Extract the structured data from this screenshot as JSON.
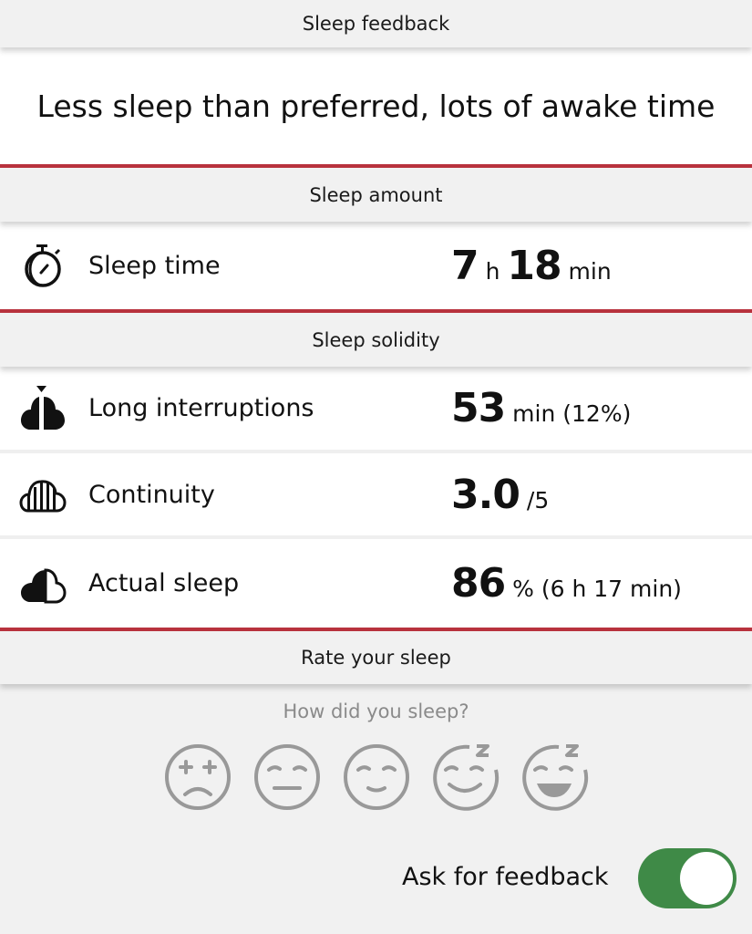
{
  "header": {
    "title": "Sleep feedback"
  },
  "feedback": {
    "text": "Less sleep than preferred, lots of awake time"
  },
  "sections": {
    "amount": "Sleep amount",
    "solidity": "Sleep solidity",
    "rate": "Rate your sleep"
  },
  "metrics": {
    "sleep_time": {
      "icon": "stopwatch-moon-icon",
      "label": "Sleep time",
      "hours": "7",
      "hours_unit": " h ",
      "minutes": "18",
      "minutes_unit": " min"
    },
    "long_interruptions": {
      "icon": "interrupted-cloud-icon",
      "label": "Long interruptions",
      "value": "53",
      "detail": " min (12%)"
    },
    "continuity": {
      "icon": "striped-cloud-icon",
      "label": "Continuity",
      "value": "3.0",
      "detail": " /5"
    },
    "actual_sleep": {
      "icon": "half-filled-cloud-icon",
      "label": "Actual sleep",
      "value": "86",
      "detail": " % (6 h 17 min)"
    }
  },
  "rating": {
    "prompt": "How did you sleep?",
    "options": [
      "very-bad-face",
      "bad-face",
      "neutral-face",
      "good-sleepy-face",
      "very-good-sleepy-face"
    ],
    "selected": null,
    "icon_color": "#999999"
  },
  "ask_feedback": {
    "label": "Ask for feedback",
    "enabled": true,
    "color": "#3f8a47"
  },
  "colors": {
    "accent_red": "#b8323d",
    "background": "#f1f1f1"
  }
}
